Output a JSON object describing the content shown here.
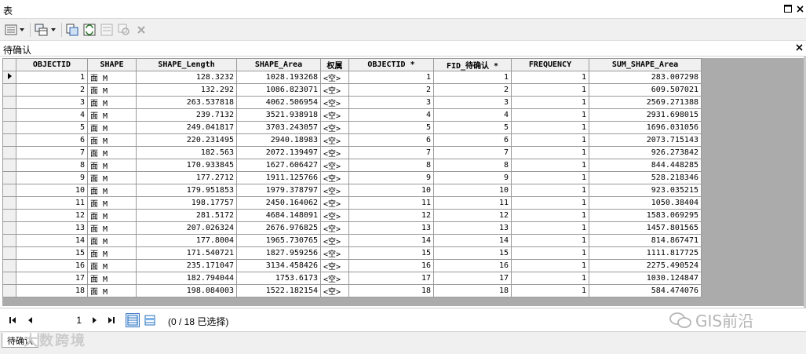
{
  "window": {
    "title": "表"
  },
  "tab": {
    "label": "待确认"
  },
  "table": {
    "columns": [
      "OBJECTID",
      "SHAPE",
      "SHAPE_Length",
      "SHAPE_Area",
      "权属",
      "OBJECTID *",
      "FID_待确认 *",
      "FREQUENCY",
      "SUM_SHAPE_Area"
    ],
    "rows": [
      [
        "1",
        "面 M",
        "128.3232",
        "1028.193268",
        "<空>",
        "1",
        "1",
        "1",
        "283.007298"
      ],
      [
        "2",
        "面 M",
        "132.292",
        "1086.823071",
        "<空>",
        "2",
        "2",
        "1",
        "609.507021"
      ],
      [
        "3",
        "面 M",
        "263.537818",
        "4062.506954",
        "<空>",
        "3",
        "3",
        "1",
        "2569.271388"
      ],
      [
        "4",
        "面 M",
        "239.7132",
        "3521.938918",
        "<空>",
        "4",
        "4",
        "1",
        "2931.698015"
      ],
      [
        "5",
        "面 M",
        "249.041817",
        "3703.243057",
        "<空>",
        "5",
        "5",
        "1",
        "1696.031056"
      ],
      [
        "6",
        "面 M",
        "220.231495",
        "2940.18983",
        "<空>",
        "6",
        "6",
        "1",
        "2073.715143"
      ],
      [
        "7",
        "面 M",
        "182.563",
        "2072.139497",
        "<空>",
        "7",
        "7",
        "1",
        "926.273842"
      ],
      [
        "8",
        "面 M",
        "170.933845",
        "1627.606427",
        "<空>",
        "8",
        "8",
        "1",
        "844.448285"
      ],
      [
        "9",
        "面 M",
        "177.2712",
        "1911.125766",
        "<空>",
        "9",
        "9",
        "1",
        "528.218346"
      ],
      [
        "10",
        "面 M",
        "179.951853",
        "1979.378797",
        "<空>",
        "10",
        "10",
        "1",
        "923.035215"
      ],
      [
        "11",
        "面 M",
        "198.17757",
        "2450.164062",
        "<空>",
        "11",
        "11",
        "1",
        "1050.38404"
      ],
      [
        "12",
        "面 M",
        "281.5172",
        "4684.148091",
        "<空>",
        "12",
        "12",
        "1",
        "1583.069295"
      ],
      [
        "13",
        "面 M",
        "207.026324",
        "2676.976825",
        "<空>",
        "13",
        "13",
        "1",
        "1457.801565"
      ],
      [
        "14",
        "面 M",
        "177.8004",
        "1965.730765",
        "<空>",
        "14",
        "14",
        "1",
        "814.867471"
      ],
      [
        "15",
        "面 M",
        "171.540721",
        "1827.959256",
        "<空>",
        "15",
        "15",
        "1",
        "1111.817725"
      ],
      [
        "16",
        "面 M",
        "235.171047",
        "3134.458426",
        "<空>",
        "16",
        "16",
        "1",
        "2275.490524"
      ],
      [
        "17",
        "面 M",
        "182.794044",
        "1753.6173",
        "<空>",
        "17",
        "17",
        "1",
        "1030.124847"
      ],
      [
        "18",
        "面 M",
        "198.084003",
        "1522.182154",
        "<空>",
        "18",
        "18",
        "1",
        "584.474076"
      ]
    ]
  },
  "navigation": {
    "current_record": "1",
    "selection_status": "(0 / 18 已选择)"
  },
  "bottom_tab": {
    "label": "待确认"
  },
  "watermarks": {
    "right": "GIS前沿",
    "left": "大数跨境"
  },
  "colors": {
    "grid_background": "#ababab",
    "header_background": "#f0f0f0",
    "view_button_accent": "#1f6fbf"
  }
}
